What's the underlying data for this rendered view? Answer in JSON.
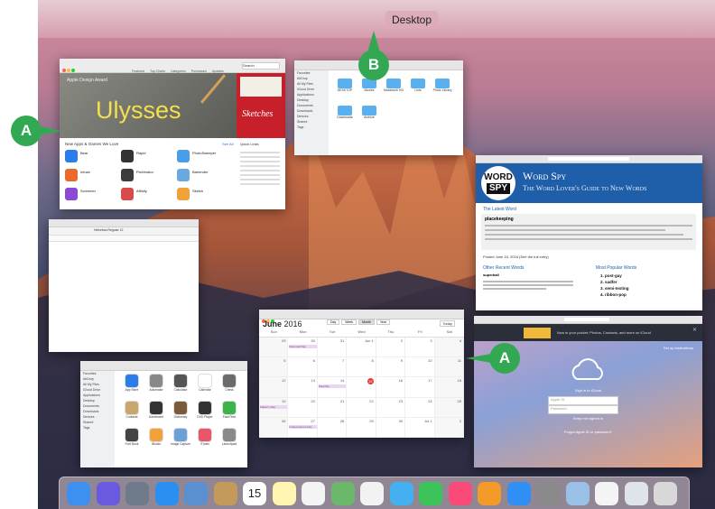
{
  "spaces_bar": {
    "desktop_label": "Desktop",
    "add_label": "+"
  },
  "callouts": {
    "a1": "A",
    "b": "B",
    "a2": "A"
  },
  "app_store": {
    "tabs": [
      "Featured",
      "Top Charts",
      "Categories",
      "Purchased",
      "Updates"
    ],
    "search": "Search",
    "banner_subtitle": "Apple Design Award",
    "banner_title": "Ulysses",
    "side_banner": "Sketches",
    "section": "New Apps & Games We Love",
    "see_all": "See All",
    "quick_links": "Quick Links",
    "apps": [
      "Bear",
      "Rapid",
      "PhotoSweeper",
      "Infuse",
      "Pixelmator",
      "Bartender",
      "Scrivener",
      "Affinity",
      "Sketch"
    ]
  },
  "finder": {
    "sidebar": [
      "Favorites",
      "AirDrop",
      "All My Files",
      "iCloud Drive",
      "Applications",
      "Desktop",
      "Documents",
      "Downloads",
      "Devices",
      "Shared",
      "Tags"
    ],
    "folders": [
      "DESKTOP",
      "Movies",
      "Macintosh HD",
      "Lists",
      "Photo Library",
      "Downloads",
      "Archive"
    ]
  },
  "word_spy": {
    "logo_top": "WORD",
    "logo_bottom": "SPY",
    "title": "Word Spy",
    "subtitle": "The Word Lover's Guide to New Words",
    "latest_heading": "The Latest Word",
    "latest_word": "placekeeping",
    "posted": "Posted June 15, 2016 (See the full entry)",
    "recent_heading": "Other Recent Words",
    "recent_word": "superball",
    "popular_heading": "Most Popular Words",
    "popular": [
      "1. post-gay",
      "2. sadfer",
      "3. semi-texting",
      "4. ribbon-pop"
    ]
  },
  "calendar": {
    "month": "June",
    "year": "2016",
    "views": [
      "Day",
      "Week",
      "Month",
      "Year"
    ],
    "today": "Today",
    "weekdays": [
      "Sun",
      "Mon",
      "Tue",
      "Wed",
      "Thu",
      "Fri",
      "Sat"
    ],
    "weeks": [
      [
        "29",
        "30",
        "31",
        "Jun 1",
        "2",
        "3",
        "4"
      ],
      [
        "5",
        "6",
        "7",
        "8",
        "9",
        "10",
        "11"
      ],
      [
        "12",
        "13",
        "14",
        "15",
        "16",
        "17",
        "18"
      ],
      [
        "19",
        "20",
        "21",
        "22",
        "23",
        "24",
        "25"
      ],
      [
        "26",
        "27",
        "28",
        "29",
        "30",
        "Jul 1",
        "2"
      ]
    ],
    "events": [
      "Memorial Day",
      "Flag Day",
      "Father's Day",
      "Independence Day"
    ]
  },
  "icloud": {
    "banner": "Now in your pocket: Photos, Contacts, and more on iCloud",
    "setup": "Set up Instructions",
    "sign_in": "Sign in to iCloud",
    "apple_id": "Apple ID",
    "password": "Password",
    "keep_signed": "Keep me signed in",
    "forgot": "Forgot Apple ID or password?"
  },
  "textedit": {
    "toolbar": "Helvetica  Regular  12"
  },
  "applications": {
    "sidebar": [
      "Favorites",
      "AirDrop",
      "All My Files",
      "iCloud Drive",
      "Applications",
      "Desktop",
      "Documents",
      "Downloads",
      "Devices",
      "Shared",
      "Tags"
    ],
    "apps": [
      "App Store",
      "Automator",
      "Calculator",
      "Calendar",
      "Chess",
      "Contacts",
      "Dashboard",
      "Dictionary",
      "DVD Player",
      "FaceTime",
      "Font Book",
      "iBooks",
      "Image Capture",
      "iTunes",
      "Launchpad"
    ]
  },
  "dock_icons": [
    "finder-icon",
    "siri-icon",
    "launchpad-icon",
    "safari-icon",
    "mail-icon",
    "contacts-icon",
    "calendar-icon",
    "notes-icon",
    "reminders-icon",
    "maps-icon",
    "photos-icon",
    "messages-icon",
    "facetime-icon",
    "itunes-icon",
    "ibooks-icon",
    "app-store-icon",
    "system-preferences-icon",
    "preview-icon",
    "textedit-icon",
    "downloads-icon",
    "trash-icon"
  ],
  "dock_calendar_day": "15",
  "colors": {
    "callout_green": "#33a852",
    "wordspy_blue": "#1f5ea8"
  }
}
